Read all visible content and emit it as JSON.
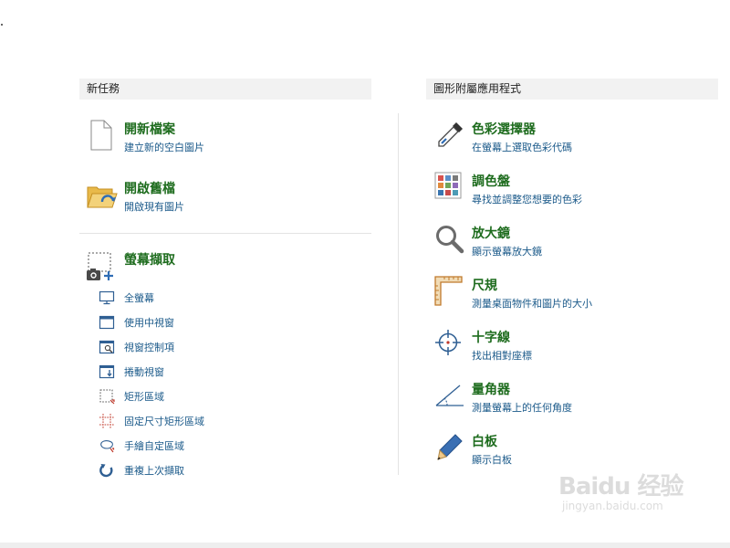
{
  "left_panel": {
    "header": "新任務",
    "tasks": [
      {
        "title": "開新檔案",
        "desc": "建立新的空白圖片",
        "icon": "blank-page-icon"
      },
      {
        "title": "開啟舊檔",
        "desc": "開啟現有圖片",
        "icon": "open-folder-icon"
      }
    ],
    "capture": {
      "title": "螢幕擷取",
      "icon": "screen-capture-camera-icon",
      "items": [
        {
          "label": "全螢幕",
          "icon": "monitor-icon"
        },
        {
          "label": "使用中視窗",
          "icon": "window-icon"
        },
        {
          "label": "視窗控制項",
          "icon": "window-control-icon"
        },
        {
          "label": "捲動視窗",
          "icon": "scroll-window-icon"
        },
        {
          "label": "矩形區域",
          "icon": "rectangle-region-icon"
        },
        {
          "label": "固定尺寸矩形區域",
          "icon": "fixed-size-region-icon"
        },
        {
          "label": "手繪自定區域",
          "icon": "freehand-region-icon"
        },
        {
          "label": "重複上次擷取",
          "icon": "repeat-capture-icon"
        }
      ]
    }
  },
  "right_panel": {
    "header": "圖形附屬應用程式",
    "tools": [
      {
        "title": "色彩選擇器",
        "desc": "在螢幕上選取色彩代碼",
        "icon": "eyedropper-icon"
      },
      {
        "title": "調色盤",
        "desc": "尋找並調整您想要的色彩",
        "icon": "color-palette-icon"
      },
      {
        "title": "放大鏡",
        "desc": "顯示螢幕放大鏡",
        "icon": "magnifier-icon"
      },
      {
        "title": "尺規",
        "desc": "測量桌面物件和圖片的大小",
        "icon": "ruler-icon"
      },
      {
        "title": "十字線",
        "desc": "找出相對座標",
        "icon": "crosshair-icon"
      },
      {
        "title": "量角器",
        "desc": "測量螢幕上的任何角度",
        "icon": "protractor-icon"
      },
      {
        "title": "白板",
        "desc": "顯示白板",
        "icon": "whiteboard-pen-icon"
      }
    ]
  },
  "watermark": {
    "brand": "Baidu 经验",
    "url": "jingyan.baidu.com"
  },
  "colors": {
    "title_green": "#1e6c1e",
    "link_blue": "#1b5a8a",
    "header_bg": "#f2f2f2"
  }
}
